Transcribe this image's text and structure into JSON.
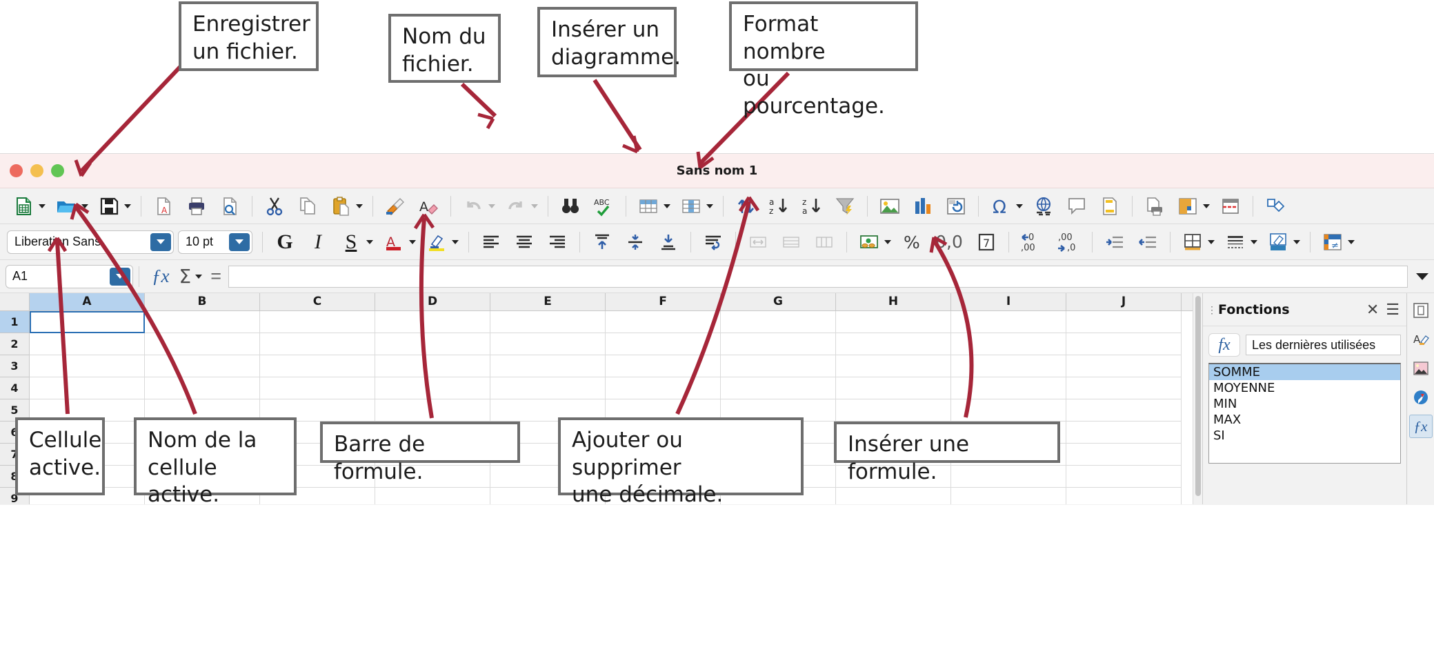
{
  "callouts": [
    {
      "id": "save-file",
      "text": "Enregistrer\nun fichier."
    },
    {
      "id": "file-name",
      "text": "Nom du\nfichier."
    },
    {
      "id": "insert-chart",
      "text": "Insérer un\ndiagramme."
    },
    {
      "id": "number-format",
      "text": "Format nombre\nou pourcentage."
    },
    {
      "id": "active-cell",
      "text": "Cellule\nactive."
    },
    {
      "id": "active-cell-name",
      "text": "Nom de la\ncellule active."
    },
    {
      "id": "formula-bar",
      "text": "Barre de formule."
    },
    {
      "id": "decimal-places",
      "text": "Ajouter ou supprimer\nune décimale."
    },
    {
      "id": "insert-formula",
      "text": "Insérer une formule."
    }
  ],
  "window": {
    "title": "Sans nom 1",
    "traffic_lights": [
      "close-red",
      "minimize-yellow",
      "maximize-green"
    ]
  },
  "standard_toolbar": [
    {
      "name": "new-document-icon",
      "caret": true
    },
    {
      "name": "open-file-icon",
      "caret": true
    },
    {
      "name": "save-file-icon",
      "caret": true
    },
    {
      "name": "export-pdf-icon",
      "caret": false
    },
    {
      "name": "print-icon",
      "caret": false
    },
    {
      "name": "print-preview-icon",
      "caret": false
    },
    {
      "name": "cut-icon",
      "caret": false
    },
    {
      "name": "copy-icon",
      "caret": false
    },
    {
      "name": "paste-icon",
      "caret": true
    },
    {
      "name": "clone-formatting-icon",
      "caret": false
    },
    {
      "name": "clear-formatting-icon",
      "caret": false
    },
    {
      "name": "undo-icon",
      "caret": true
    },
    {
      "name": "redo-icon",
      "caret": true
    },
    {
      "name": "find-replace-icon",
      "caret": false
    },
    {
      "name": "spelling-icon",
      "caret": false
    },
    {
      "name": "row-icon",
      "caret": true
    },
    {
      "name": "column-icon",
      "caret": true
    },
    {
      "name": "sort-icon",
      "caret": false
    },
    {
      "name": "sort-ascending-icon",
      "caret": false
    },
    {
      "name": "sort-descending-icon",
      "caret": false
    },
    {
      "name": "autofilter-icon",
      "caret": false
    },
    {
      "name": "insert-image-icon",
      "caret": false
    },
    {
      "name": "insert-chart-icon",
      "caret": false
    },
    {
      "name": "pivot-table-icon",
      "caret": false
    },
    {
      "name": "special-character-icon",
      "caret": true
    },
    {
      "name": "hyperlink-icon",
      "caret": false
    },
    {
      "name": "comment-icon",
      "caret": false
    },
    {
      "name": "headers-footers-icon",
      "caret": false
    },
    {
      "name": "print-area-icon",
      "caret": false
    },
    {
      "name": "freeze-rows-columns-icon",
      "caret": true
    },
    {
      "name": "split-window-icon",
      "caret": false
    },
    {
      "name": "show-draw-functions-icon",
      "caret": false
    }
  ],
  "formatting_toolbar": {
    "font_name": "Liberation Sans",
    "font_size": "10 pt",
    "bold_label": "G",
    "italic_label": "I",
    "underline_label": "S",
    "buttons": [
      {
        "name": "font-color-icon",
        "caret": true
      },
      {
        "name": "highlight-color-icon",
        "caret": true
      },
      {
        "name": "align-left-icon",
        "caret": false
      },
      {
        "name": "align-center-icon",
        "caret": false
      },
      {
        "name": "align-right-icon",
        "caret": false
      },
      {
        "name": "align-top-icon",
        "caret": false
      },
      {
        "name": "align-vcenter-icon",
        "caret": false
      },
      {
        "name": "align-bottom-icon",
        "caret": false
      },
      {
        "name": "wrap-text-icon",
        "caret": false
      },
      {
        "name": "merge-and-center-cells-icon",
        "caret": false
      },
      {
        "name": "merge-cells-icon",
        "caret": false
      },
      {
        "name": "unmerge-cells-icon",
        "caret": false
      },
      {
        "name": "currency-format-icon",
        "caret": true
      },
      {
        "name": "percent-format-icon",
        "caret": false
      },
      {
        "name": "number-format-icon",
        "caret": false
      },
      {
        "name": "date-format-icon",
        "caret": false
      },
      {
        "name": "add-decimal-place-icon",
        "caret": false
      },
      {
        "name": "delete-decimal-place-icon",
        "caret": false
      },
      {
        "name": "increase-indent-icon",
        "caret": false
      },
      {
        "name": "decrease-indent-icon",
        "caret": false
      },
      {
        "name": "borders-icon",
        "caret": true
      },
      {
        "name": "border-style-icon",
        "caret": true
      },
      {
        "name": "background-color-icon",
        "caret": true
      },
      {
        "name": "conditional-formatting-icon",
        "caret": true
      }
    ],
    "percent_label": "%",
    "number_label": "0,0",
    "date_label": "7"
  },
  "formula_bar": {
    "name_box_value": "A1",
    "function_wizard_icon": "fx-icon",
    "sum_icon": "sum-sigma-icon",
    "formula_icon": "equals-icon",
    "input_value": "",
    "expand_icon": "chevron-down-icon"
  },
  "grid": {
    "columns": [
      "A",
      "B",
      "C",
      "D",
      "E",
      "F",
      "G",
      "H",
      "I",
      "J"
    ],
    "rows": [
      "1",
      "2",
      "3",
      "4",
      "5",
      "6",
      "7",
      "8",
      "9"
    ],
    "selected_column": "A",
    "selected_row": "1",
    "active_cell": "A1"
  },
  "sidebar": {
    "title": "Fonctions",
    "close_icon": "close-icon",
    "menu_icon": "hamburger-menu-icon",
    "fx_label": "fx",
    "category_value": "Les dernières utilisées",
    "functions": [
      {
        "label": "SOMME",
        "selected": true
      },
      {
        "label": "MOYENNE",
        "selected": false
      },
      {
        "label": "MIN",
        "selected": false
      },
      {
        "label": "MAX",
        "selected": false
      },
      {
        "label": "SI",
        "selected": false
      }
    ],
    "rail": [
      {
        "name": "sidebar-settings-icon",
        "active": false
      },
      {
        "name": "styles-icon",
        "active": false
      },
      {
        "name": "gallery-icon",
        "active": false
      },
      {
        "name": "navigator-icon",
        "active": false
      },
      {
        "name": "functions-icon",
        "active": true
      }
    ]
  },
  "colors": {
    "arrow": "#a62639",
    "selection_blue": "#b5d2ee",
    "accent_blue": "#2e6ca4",
    "titlebar": "#fbeeee",
    "callout_border": "#6e6e6e"
  }
}
